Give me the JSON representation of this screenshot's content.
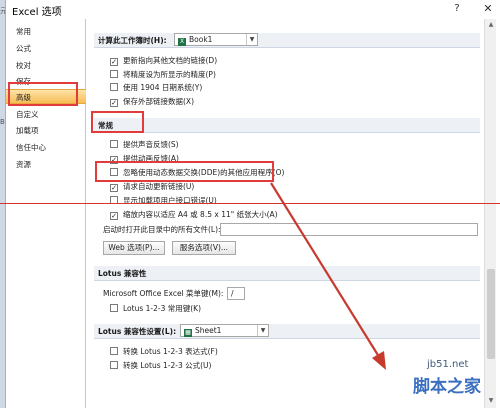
{
  "window": {
    "title": "Excel 选项",
    "help": "?",
    "close": "✕"
  },
  "left_edge": {
    "a": "元",
    "b": "B"
  },
  "sidebar": {
    "items": [
      {
        "label": "常用"
      },
      {
        "label": "公式"
      },
      {
        "label": "校对"
      },
      {
        "label": "保存"
      },
      {
        "label": "高级",
        "active": true
      },
      {
        "label": "自定义"
      },
      {
        "label": "加载项"
      },
      {
        "label": "信任中心"
      },
      {
        "label": "资源"
      }
    ]
  },
  "section_calc": {
    "title": "计算此工作簿时(H):",
    "workbook_value": "Book1",
    "options": [
      {
        "label": "更新指向其他文档的链接(D)",
        "checked": true
      },
      {
        "label": "将精度设为所显示的精度(P)",
        "checked": false
      },
      {
        "label": "使用 1904 日期系统(Y)",
        "checked": false
      },
      {
        "label": "保存外部链接数据(X)",
        "checked": true
      }
    ]
  },
  "section_general": {
    "title": "常规",
    "options": [
      {
        "label": "提供声音反馈(S)",
        "checked": false
      },
      {
        "label": "提供动画反馈(A)",
        "checked": true
      },
      {
        "label": "忽略使用动态数据交换(DDE)的其他应用程序(O)",
        "checked": false
      },
      {
        "label": "请求自动更新链接(U)",
        "checked": true
      },
      {
        "label": "显示加载项用户接口错误(U)",
        "checked": false
      },
      {
        "label": "缩放内容以适应 A4 或 8.5 x 11\" 纸张大小(A)",
        "checked": true
      }
    ],
    "startup_label": "启动时打开此目录中的所有文件(L):",
    "startup_value": "",
    "web_options_button": "Web 选项(P)...",
    "service_options_button": "服务选项(V)..."
  },
  "section_lotus": {
    "title": "Lotus 兼容性",
    "menu_key_label": "Microsoft Office Excel 菜单键(M):",
    "menu_key_value": "/",
    "options": [
      {
        "label": "Lotus 1-2-3 常用键(K)",
        "checked": false
      }
    ]
  },
  "section_lotus_settings": {
    "title": "Lotus 兼容性设置(L):",
    "sheet_value": "Sheet1",
    "options": [
      {
        "label": "转换 Lotus 1-2-3 表达式(F)",
        "checked": false
      },
      {
        "label": "转换 Lotus 1-2-3 公式(U)",
        "checked": false
      }
    ]
  },
  "watermark": {
    "top": "jb51.net",
    "main": "脚本之家"
  },
  "colors": {
    "highlight": "#e23b3b",
    "active_nav": "#f8bd55"
  }
}
